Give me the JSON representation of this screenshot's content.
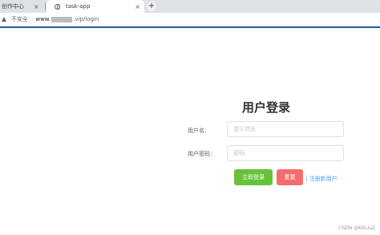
{
  "browser": {
    "tabs": [
      {
        "label": "创作中心",
        "close": "×"
      },
      {
        "label": "task-app",
        "close": "×"
      }
    ],
    "new_tab": "+",
    "address": {
      "security_label": "不安全",
      "separator": "|",
      "url_prefix": "www.",
      "url_suffix": ".vip/login"
    }
  },
  "login": {
    "title": "用户登录",
    "username_label": "用户名：",
    "username_placeholder": "提示信息",
    "password_label": "用户密码：",
    "password_placeholder": "密码",
    "login_button": "立即登录",
    "reset_button": "重置",
    "register_link": "| 注册新用户"
  },
  "watermark": "CSDN @KKLiuZ",
  "colors": {
    "login_button": "#67c23a",
    "reset_button": "#f56c6c",
    "link": "#409eff",
    "accent_line": "#2b5fa6"
  }
}
